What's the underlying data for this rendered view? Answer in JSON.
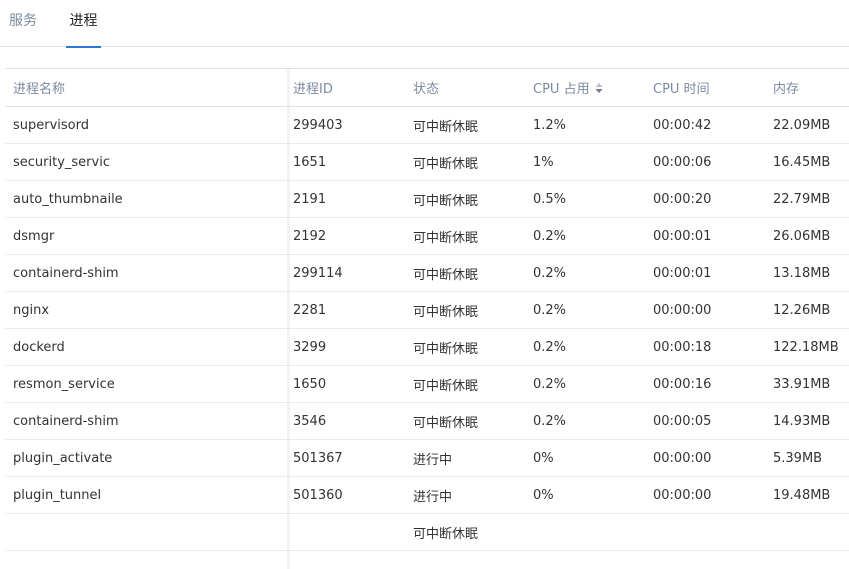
{
  "tabs": [
    {
      "label": "服务"
    },
    {
      "label": "进程",
      "active": true
    }
  ],
  "table": {
    "headers": {
      "name": "进程名称",
      "pid": "进程ID",
      "state": "状态",
      "cpu": "CPU 占用",
      "cpu_time": "CPU 时间",
      "memory": "内存"
    },
    "rows": [
      {
        "name": "supervisord",
        "pid": "299403",
        "state": "可中断休眠",
        "cpu": "1.2%",
        "cpu_time": "00:00:42",
        "memory": "22.09MB"
      },
      {
        "name": "security_servic",
        "pid": "1651",
        "state": "可中断休眠",
        "cpu": "1%",
        "cpu_time": "00:00:06",
        "memory": "16.45MB"
      },
      {
        "name": "auto_thumbnaile",
        "pid": "2191",
        "state": "可中断休眠",
        "cpu": "0.5%",
        "cpu_time": "00:00:20",
        "memory": "22.79MB"
      },
      {
        "name": "dsmgr",
        "pid": "2192",
        "state": "可中断休眠",
        "cpu": "0.2%",
        "cpu_time": "00:00:01",
        "memory": "26.06MB"
      },
      {
        "name": "containerd-shim",
        "pid": "299114",
        "state": "可中断休眠",
        "cpu": "0.2%",
        "cpu_time": "00:00:01",
        "memory": "13.18MB"
      },
      {
        "name": "nginx",
        "pid": "2281",
        "state": "可中断休眠",
        "cpu": "0.2%",
        "cpu_time": "00:00:00",
        "memory": "12.26MB"
      },
      {
        "name": "dockerd",
        "pid": "3299",
        "state": "可中断休眠",
        "cpu": "0.2%",
        "cpu_time": "00:00:18",
        "memory": "122.18MB"
      },
      {
        "name": "resmon_service",
        "pid": "1650",
        "state": "可中断休眠",
        "cpu": "0.2%",
        "cpu_time": "00:00:16",
        "memory": "33.91MB"
      },
      {
        "name": "containerd-shim",
        "pid": "3546",
        "state": "可中断休眠",
        "cpu": "0.2%",
        "cpu_time": "00:00:05",
        "memory": "14.93MB"
      },
      {
        "name": "plugin_activate",
        "pid": "501367",
        "state": "进行中",
        "cpu": "0%",
        "cpu_time": "00:00:00",
        "memory": "5.39MB"
      },
      {
        "name": "plugin_tunnel",
        "pid": "501360",
        "state": "进行中",
        "cpu": "0%",
        "cpu_time": "00:00:00",
        "memory": "19.48MB"
      },
      {
        "name": "",
        "pid": "",
        "state": "可中断休眠",
        "cpu": "",
        "cpu_time": "",
        "memory": ""
      }
    ]
  }
}
